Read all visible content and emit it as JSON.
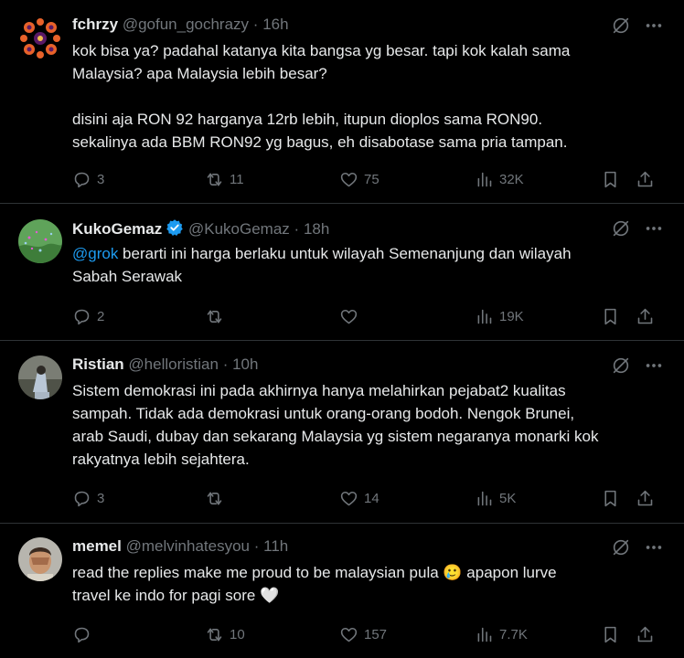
{
  "tweets": [
    {
      "name": "fchrzy",
      "handle": "@gofun_gochrazy",
      "time": "16h",
      "lines": [
        "kok bisa ya? padahal katanya kita bangsa yg besar. tapi kok kalah sama",
        "Malaysia? apa Malaysia lebih besar?",
        "",
        "disini aja RON 92 harganya 12rb lebih, itupun dioplos sama RON90.",
        "sekalinya ada BBM RON92 yg bagus, eh disabotase sama pria tampan."
      ],
      "replies": "3",
      "retweets": "11",
      "likes": "75",
      "views": "32K"
    },
    {
      "name": "KukoGemaz",
      "handle": "@KukoGemaz",
      "time": "18h",
      "mention": "@grok",
      "line1_rest": " berarti ini harga berlaku untuk wilayah Semenanjung dan wilayah",
      "line2": "Sabah Serawak",
      "replies": "2",
      "retweets": "",
      "likes": "",
      "views": "19K"
    },
    {
      "name": "Ristian",
      "handle": "@helloristian",
      "time": "10h",
      "lines": [
        "Sistem demokrasi ini pada akhirnya hanya melahirkan pejabat2 kualitas",
        "sampah. Tidak ada demokrasi untuk orang-orang bodoh. Nengok Brunei,",
        "arab Saudi, dubay dan sekarang Malaysia yg sistem negaranya monarki kok",
        "rakyatnya lebih sejahtera."
      ],
      "replies": "3",
      "retweets": "",
      "likes": "14",
      "views": "5K"
    },
    {
      "name": "memel",
      "handle": "@melvinhatesyou",
      "time": "11h",
      "line1": "read the replies make me proud to be malaysian pula ",
      "line1_emoji": "🥲",
      "line1_rest": " apapon lurve",
      "line2": "travel ke indo for pagi sore ",
      "line2_emoji": "🤍",
      "replies": "",
      "retweets": "10",
      "likes": "157",
      "views": "7.7K"
    }
  ],
  "separator": "·"
}
